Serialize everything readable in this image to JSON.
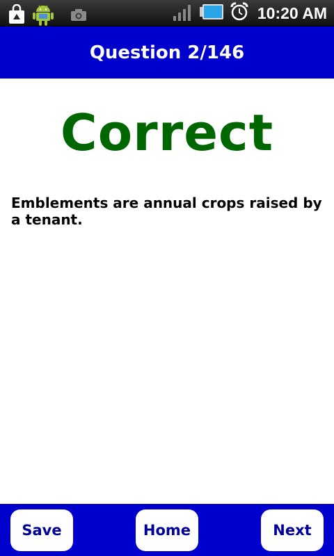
{
  "status_bar": {
    "time": "10:20 AM",
    "icons": [
      "shopping-bag-icon",
      "android-robot-icon",
      "camera-icon",
      "signal-bars-icon",
      "battery-icon",
      "alarm-clock-icon"
    ]
  },
  "header": {
    "title": "Question 2/146",
    "background": "#0000cc"
  },
  "main": {
    "result": "Correct",
    "result_color": "#006600",
    "explanation": "Emblements are annual crops raised by a tenant."
  },
  "footer": {
    "save_label": "Save",
    "home_label": "Home",
    "next_label": "Next",
    "background": "#0000cc"
  }
}
